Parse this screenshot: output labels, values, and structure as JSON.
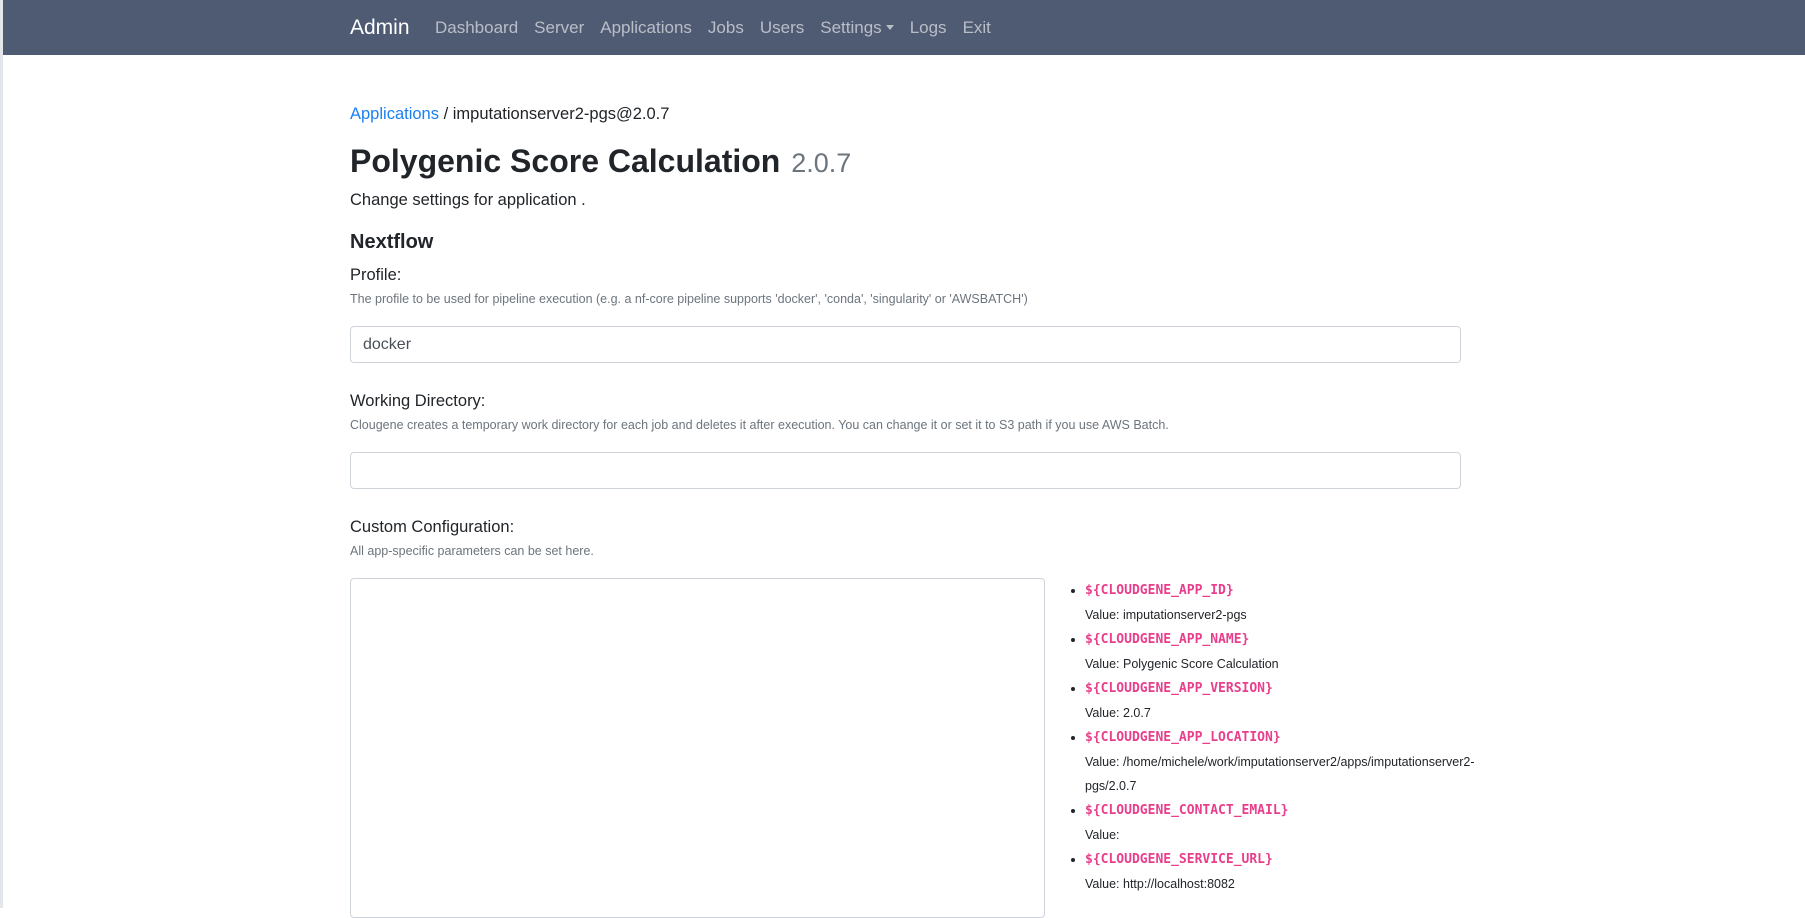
{
  "nav": {
    "brand": "Admin",
    "items": [
      {
        "label": "Dashboard"
      },
      {
        "label": "Server"
      },
      {
        "label": "Applications"
      },
      {
        "label": "Jobs"
      },
      {
        "label": "Users"
      },
      {
        "label": "Settings",
        "dropdown": true
      },
      {
        "label": "Logs"
      },
      {
        "label": "Exit"
      }
    ]
  },
  "breadcrumb": {
    "link": "Applications",
    "separator": " / ",
    "current": "imputationserver2-pgs@2.0.7"
  },
  "page": {
    "title": "Polygenic Score Calculation",
    "version": "2.0.7",
    "lead": "Change settings for application ."
  },
  "nextflow": {
    "heading": "Nextflow",
    "profile": {
      "label": "Profile:",
      "help": "The profile to be used for pipeline execution (e.g. a nf-core pipeline supports 'docker', 'conda', 'singularity' or 'AWSBATCH')",
      "value": "docker"
    },
    "workdir": {
      "label": "Working Directory:",
      "help": "Clougene creates a temporary work directory for each job and deletes it after execution. You can change it or set it to S3 path if you use AWS Batch.",
      "value": ""
    },
    "custom": {
      "label": "Custom Configuration:",
      "help": "All app-specific parameters can be set here.",
      "value": ""
    }
  },
  "variables": [
    {
      "name": "${CLOUDGENE_APP_ID}",
      "value": "Value: imputationserver2-pgs"
    },
    {
      "name": "${CLOUDGENE_APP_NAME}",
      "value": "Value: Polygenic Score Calculation"
    },
    {
      "name": "${CLOUDGENE_APP_VERSION}",
      "value": "Value: 2.0.7"
    },
    {
      "name": "${CLOUDGENE_APP_LOCATION}",
      "value": "Value: /home/michele/work/imputationserver2/apps/imputationserver2-pgs/2.0.7"
    },
    {
      "name": "${CLOUDGENE_CONTACT_EMAIL}",
      "value": "Value:"
    },
    {
      "name": "${CLOUDGENE_SERVICE_URL}",
      "value": "Value: http://localhost:8082"
    }
  ],
  "colors": {
    "navbar": "#4f5b73",
    "link": "#1a7ff5",
    "code": "#e83e8c",
    "muted": "#6c757d"
  }
}
